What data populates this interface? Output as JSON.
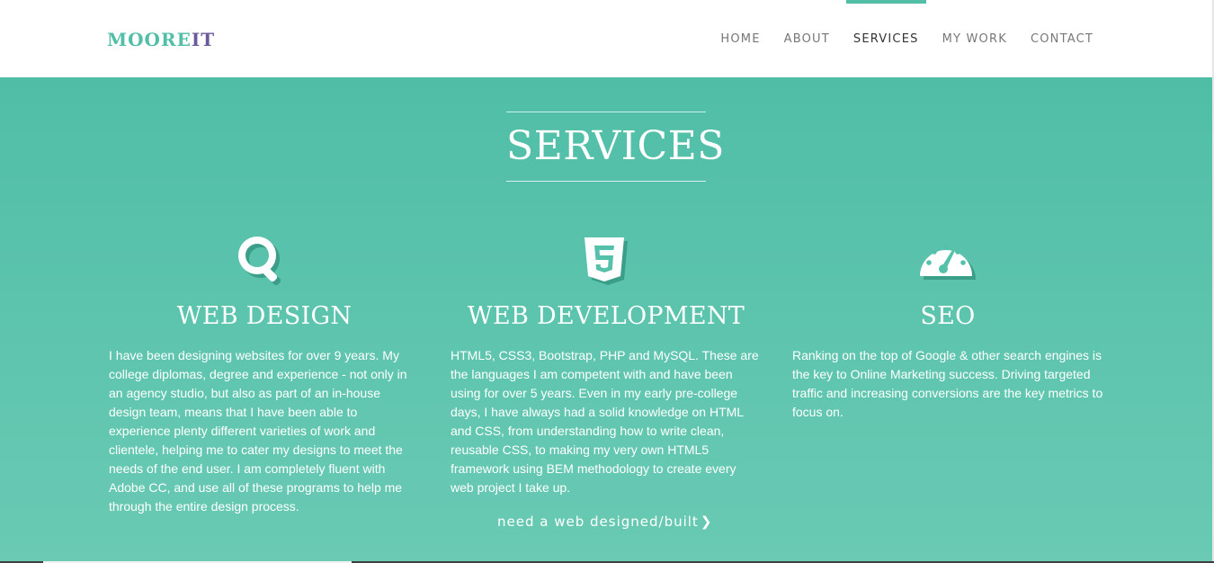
{
  "header": {
    "logo_part1": "MOORE",
    "logo_part2": "IT",
    "nav": [
      "HOME",
      "ABOUT",
      "SERVICES",
      "MY WORK",
      "CONTACT"
    ],
    "active_nav": "SERVICES"
  },
  "section": {
    "title": "SERVICES"
  },
  "services": [
    {
      "icon": "search-icon",
      "title": "WEB DESIGN",
      "text": "I have been designing websites for over 9 years. My college diplomas, degree and experience - not only in an agency studio, but also as part of an in-house design team, means that I have been able to experience plenty different varieties of work and clientele, helping me to cater my designs to meet the needs of the end user. I am completely fluent with Adobe CC, and use all of these programs to help me through the entire design process."
    },
    {
      "icon": "html5-icon",
      "title": "WEB DEVELOPMENT",
      "text": "HTML5, CSS3, Bootstrap, PHP and MySQL. These are the languages I am competent with and have been using for over 5 years. Even in my early pre-college days, I have always had a solid knowledge on HTML and CSS, from understanding how to write clean, reusable CSS, to making my very own HTML5 framework using BEM methodology to create every web project I take up."
    },
    {
      "icon": "dashboard-icon",
      "title": "SEO",
      "text": "Ranking on the top of Google & other search engines is the key to Online Marketing success. Driving targeted traffic and increasing conversions are the key metrics to focus on."
    }
  ],
  "cta": {
    "label": "need a web designed/built",
    "icon": "chevron-right-icon"
  },
  "colors": {
    "accent": "#52bea8",
    "logo_secondary": "#6b5a9b",
    "hero_top": "#50bea7",
    "hero_bottom": "#6acab4",
    "icon_shadow": "#3a9e89"
  }
}
